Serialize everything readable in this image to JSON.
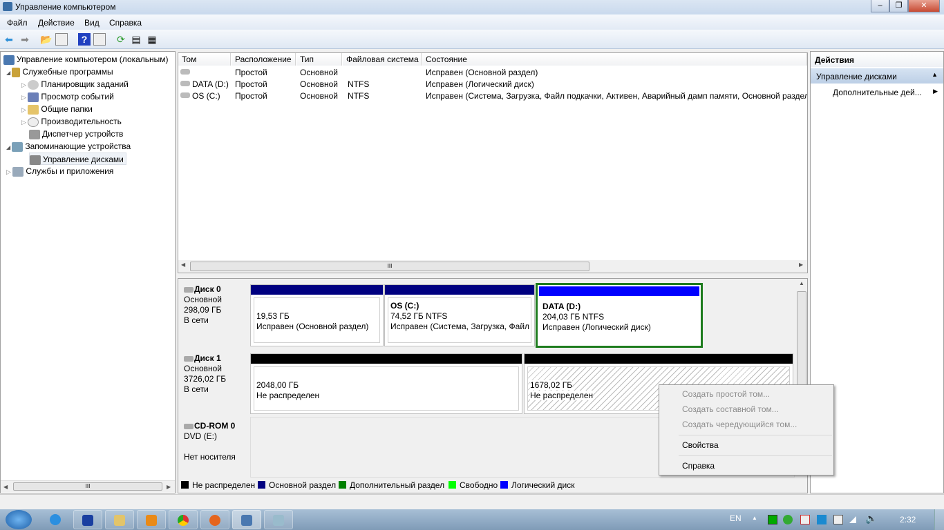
{
  "window": {
    "title": "Управление компьютером"
  },
  "menu": [
    "Файл",
    "Действие",
    "Вид",
    "Справка"
  ],
  "tree": {
    "root": "Управление компьютером (локальным)",
    "items": [
      {
        "label": "Служебные программы",
        "level": 1,
        "expander": "◢"
      },
      {
        "label": "Планировщик заданий",
        "level": 2,
        "expander": "▷"
      },
      {
        "label": "Просмотр событий",
        "level": 2,
        "expander": "▷"
      },
      {
        "label": "Общие папки",
        "level": 2,
        "expander": "▷"
      },
      {
        "label": "Производительность",
        "level": 2,
        "expander": "▷"
      },
      {
        "label": "Диспетчер устройств",
        "level": 2,
        "expander": ""
      },
      {
        "label": "Запоминающие устройства",
        "level": 1,
        "expander": "◢"
      },
      {
        "label": "Управление дисками",
        "level": 2,
        "expander": "",
        "selected": true
      },
      {
        "label": "Службы и приложения",
        "level": 1,
        "expander": "▷"
      }
    ]
  },
  "table": {
    "headers": [
      "Том",
      "Расположение",
      "Тип",
      "Файловая система",
      "Состояние"
    ],
    "rows": [
      [
        "",
        "Простой",
        "Основной",
        "",
        "Исправен (Основной раздел)"
      ],
      [
        "DATA (D:)",
        "Простой",
        "Основной",
        "NTFS",
        "Исправен (Логический диск)"
      ],
      [
        "OS (C:)",
        "Простой",
        "Основной",
        "NTFS",
        "Исправен (Система, Загрузка, Файл подкачки, Активен, Аварийный дамп памяти, Основной раздел)"
      ]
    ],
    "scroll_grip": "III"
  },
  "disks": [
    {
      "name": "Диск 0",
      "type": "Основной",
      "size": "298,09 ГБ",
      "status": "В сети",
      "partitions": [
        {
          "name": "",
          "size": "19,53 ГБ",
          "status": "Исправен (Основной раздел)"
        },
        {
          "name": "OS  (C:)",
          "size": "74,52 ГБ NTFS",
          "status": "Исправен (Система, Загрузка, Файл г"
        },
        {
          "name": "DATA  (D:)",
          "size": "204,03 ГБ NTFS",
          "status": "Исправен (Логический диск)"
        }
      ]
    },
    {
      "name": "Диск 1",
      "type": "Основной",
      "size": "3726,02 ГБ",
      "status": "В сети",
      "partitions": [
        {
          "size": "2048,00 ГБ",
          "status": "Не распределен"
        },
        {
          "size": "1678,02 ГБ",
          "status": "Не распределен"
        }
      ]
    },
    {
      "name": "CD-ROM 0",
      "type": "DVD (E:)",
      "status": "Нет носителя"
    }
  ],
  "legend": [
    {
      "label": "Не распределен",
      "color": "#000000"
    },
    {
      "label": "Основной раздел",
      "color": "#000080"
    },
    {
      "label": "Дополнительный раздел",
      "color": "#008000"
    },
    {
      "label": "Свободно",
      "color": "#00ff00"
    },
    {
      "label": "Логический диск",
      "color": "#0000ff"
    }
  ],
  "actions": {
    "title": "Действия",
    "section": "Управление дисками",
    "item": "Дополнительные дей..."
  },
  "context_menu": [
    "Создать простой том...",
    "Создать составной том...",
    "Создать чередующийся том...",
    "Свойства",
    "Справка"
  ],
  "tray": {
    "lang": "EN",
    "time": "2:32"
  }
}
